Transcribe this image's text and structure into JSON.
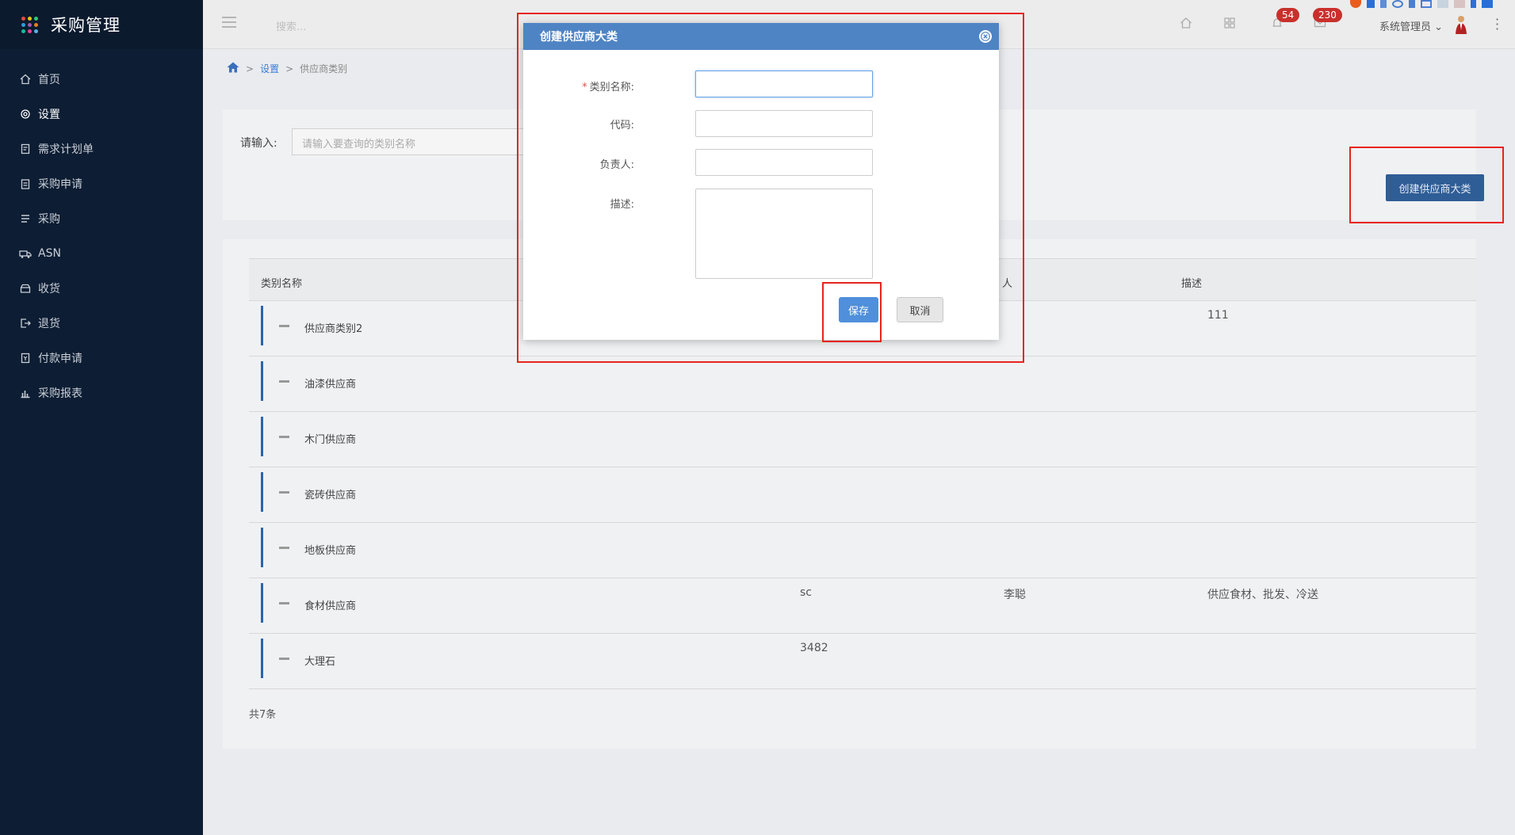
{
  "app": {
    "title": "采购管理"
  },
  "sidebar": {
    "items": [
      {
        "label": "首页",
        "icon": "home-icon"
      },
      {
        "label": "设置",
        "icon": "gear-icon"
      },
      {
        "label": "需求计划单",
        "icon": "document-icon"
      },
      {
        "label": "采购申请",
        "icon": "clipboard-icon"
      },
      {
        "label": "采购",
        "icon": "list-icon"
      },
      {
        "label": "ASN",
        "icon": "truck-icon"
      },
      {
        "label": "收货",
        "icon": "inbox-icon"
      },
      {
        "label": "退货",
        "icon": "exit-icon"
      },
      {
        "label": "付款申请",
        "icon": "payment-icon"
      },
      {
        "label": "采购报表",
        "icon": "bar-chart-icon"
      }
    ],
    "active_index": 1
  },
  "topbar": {
    "search_placeholder": "搜索...",
    "notifications_count": "54",
    "messages_count": "230",
    "user_name": "系统管理员"
  },
  "breadcrumb": {
    "level1": "设置",
    "level2": "供应商类别",
    "sep": ">"
  },
  "filter": {
    "label": "请输入:",
    "placeholder": "请输入要查询的类别名称",
    "create_button": "创建供应商大类"
  },
  "table": {
    "headers": {
      "name": "类别名称",
      "person": "人",
      "desc": "描述"
    },
    "rows": [
      {
        "name": "供应商类别2",
        "code": "",
        "person": "",
        "desc": "111"
      },
      {
        "name": "油漆供应商",
        "code": "",
        "person": "",
        "desc": ""
      },
      {
        "name": "木门供应商",
        "code": "",
        "person": "",
        "desc": ""
      },
      {
        "name": "瓷砖供应商",
        "code": "",
        "person": "",
        "desc": ""
      },
      {
        "name": "地板供应商",
        "code": "",
        "person": "",
        "desc": ""
      },
      {
        "name": "食材供应商",
        "code": "sc",
        "person": "李聪",
        "desc": "供应食材、批发、冷送"
      },
      {
        "name": "大理石",
        "code": "3482",
        "person": "",
        "desc": ""
      }
    ],
    "total": "共7条"
  },
  "dialog": {
    "title": "创建供应商大类",
    "required_mark": "*",
    "name_label": "类别名称:",
    "code_label": "代码:",
    "person_label": "负责人:",
    "desc_label": "描述:",
    "name_value": "",
    "code_value": "",
    "person_value": "",
    "desc_value": "",
    "save_button": "保存",
    "cancel_button": "取消"
  },
  "colors": {
    "sidebar_bg": "#0d1d33",
    "accent": "#4f84c4",
    "primary_button": "#2f5d96",
    "badge": "#c9302c",
    "highlight": "#e8241d"
  }
}
